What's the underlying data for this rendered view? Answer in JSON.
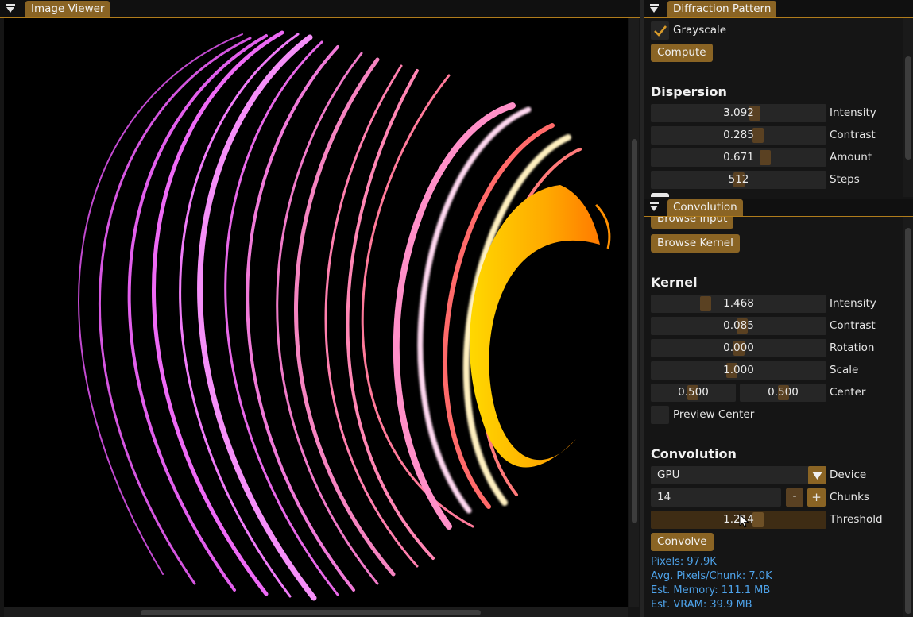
{
  "viewer": {
    "title": "Image Viewer"
  },
  "diffraction": {
    "title": "Diffraction Pattern",
    "grayscale_label": "Grayscale",
    "grayscale_checked": true,
    "compute_label": "Compute",
    "dispersion_heading": "Dispersion",
    "sliders": [
      {
        "label": "Intensity",
        "value": "3.092",
        "fraction": 0.6
      },
      {
        "label": "Contrast",
        "value": "0.285",
        "fraction": 0.62
      },
      {
        "label": "Amount",
        "value": "0.671",
        "fraction": 0.66
      },
      {
        "label": "Steps",
        "value": "512",
        "fraction": 0.5
      }
    ]
  },
  "convolution": {
    "title": "Convolution",
    "browse_input_label": "Browse Input",
    "browse_kernel_label": "Browse Kernel",
    "kernel_heading": "Kernel",
    "kernel_sliders": [
      {
        "label": "Intensity",
        "value": "1.468",
        "fraction": 0.3
      },
      {
        "label": "Contrast",
        "value": "0.085",
        "fraction": 0.52
      },
      {
        "label": "Rotation",
        "value": "0.000",
        "fraction": 0.5
      },
      {
        "label": "Scale",
        "value": "1.000",
        "fraction": 0.46
      }
    ],
    "center": {
      "label": "Center",
      "x": "0.500",
      "y": "0.500"
    },
    "preview_center_label": "Preview Center",
    "convolution_heading": "Convolution",
    "device": {
      "label": "Device",
      "value": "GPU"
    },
    "chunks": {
      "label": "Chunks",
      "value": "14",
      "minus": "-",
      "plus": "+"
    },
    "threshold": {
      "label": "Threshold",
      "value": "1.214",
      "fraction": 0.62
    },
    "convolve_label": "Convolve",
    "stats": {
      "pixels": "Pixels: 97.9K",
      "avg": "Avg. Pixels/Chunk: 7.0K",
      "memory": "Est. Memory: 111.1 MB",
      "vram": "Est. VRAM: 39.9 MB"
    }
  },
  "icons": {
    "collapse": "triangle-down-icon",
    "check": "checkmark-icon",
    "dropdown": "triangle-down-icon",
    "cursor": "mouse-pointer-icon"
  },
  "colors": {
    "accent": "#8a6424",
    "accent_line": "#b07c1c",
    "info": "#4ea3ea",
    "magenta": "#e85ef0",
    "pink": "#ff8fc8",
    "orange": "#ff9a00",
    "yellow": "#ffe000"
  }
}
